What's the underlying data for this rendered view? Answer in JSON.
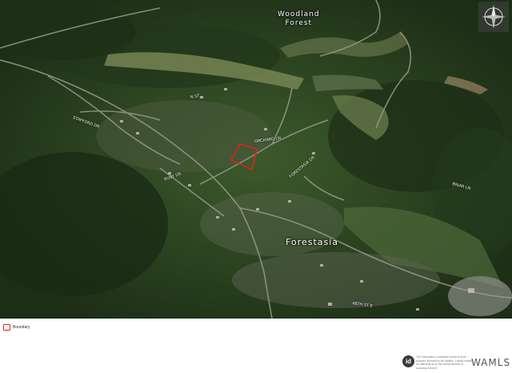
{
  "map": {
    "place_labels": {
      "woodland_forest_line1": "Woodland",
      "woodland_forest_line2": "Forest",
      "forestasia": "Forestasia"
    },
    "street_labels": [
      "ORCHARD LN",
      "FORESTASIA DR",
      "48TH ST E",
      "STAFFORD DR",
      "N ST",
      "RUBY DR",
      "BRIAR LN"
    ],
    "boundary_color": "#e02020",
    "compass_icon": "compass-rose-icon"
  },
  "legend": {
    "label": "Boundary",
    "swatch_color": "#d22222"
  },
  "footer": {
    "logo_text": "id",
    "disclaimer": "The information contained herein is from sources deemed to be reliable. Landid makes no warranty as to the completeness or accuracy thereof.",
    "brand": "WAMLS"
  }
}
